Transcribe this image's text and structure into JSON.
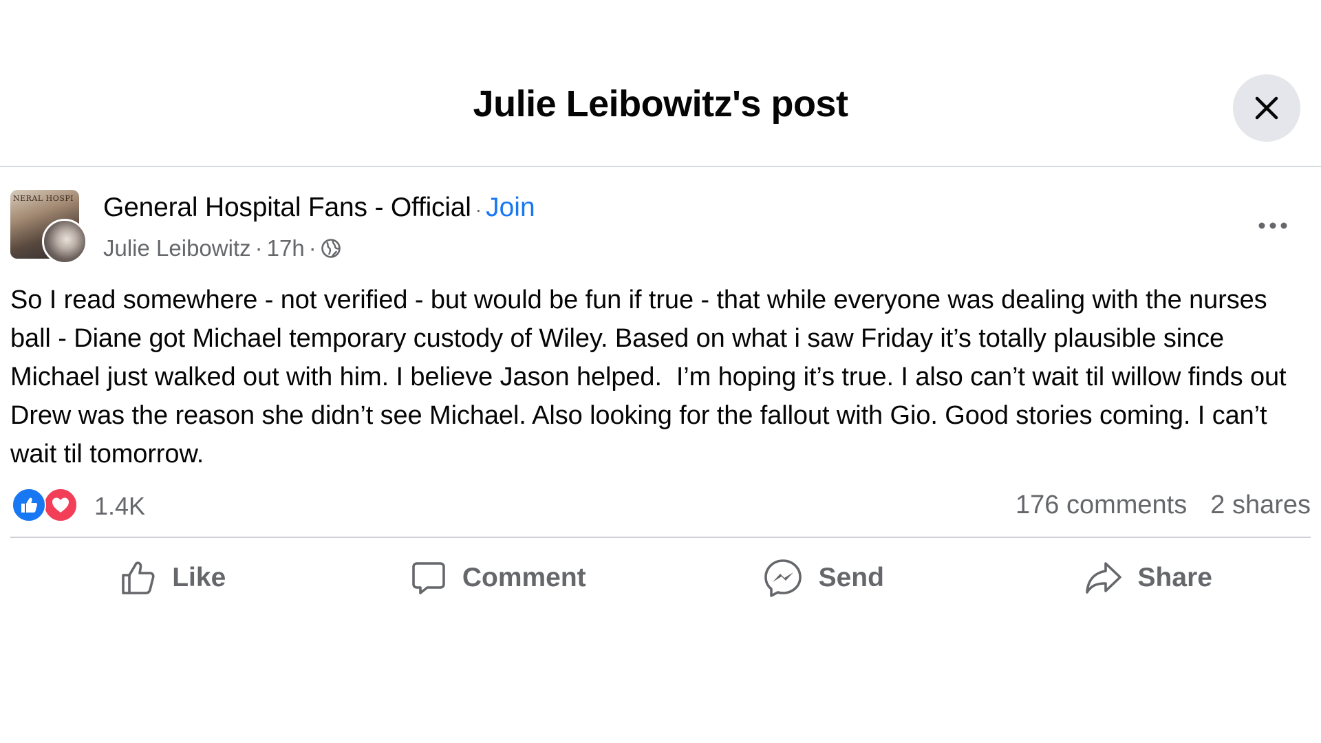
{
  "dialog": {
    "title": "Julie Leibowitz's post"
  },
  "post": {
    "group_name": "General Hospital Fans - Official",
    "join_label": "Join",
    "group_avatar_text": "NERAL HOSPI",
    "author": "Julie Leibowitz",
    "time": "17h",
    "privacy_icon": "globe-icon",
    "body": "So I read somewhere - not verified - but would be fun if true - that while everyone was dealing with the nurses ball - Diane got Michael temporary custody of Wiley. Based on what i saw Friday it’s totally plausible since Michael just walked out with him. I believe Jason helped.  I’m hoping it’s true. I also can’t wait til willow finds out Drew was the reason she didn’t see Michael. Also looking for the fallout with Gio. Good stories coming. I can’t wait til tomorrow.",
    "reactions": {
      "types": [
        "like",
        "love"
      ],
      "count": "1.4K"
    },
    "comments_label": "176 comments",
    "shares_label": "2 shares"
  },
  "actions": {
    "like": "Like",
    "comment": "Comment",
    "send": "Send",
    "share": "Share"
  },
  "colors": {
    "accent": "#1877f2",
    "secondary_text": "#65676b",
    "love": "#f33e58",
    "close_bg": "#e4e6eb"
  }
}
